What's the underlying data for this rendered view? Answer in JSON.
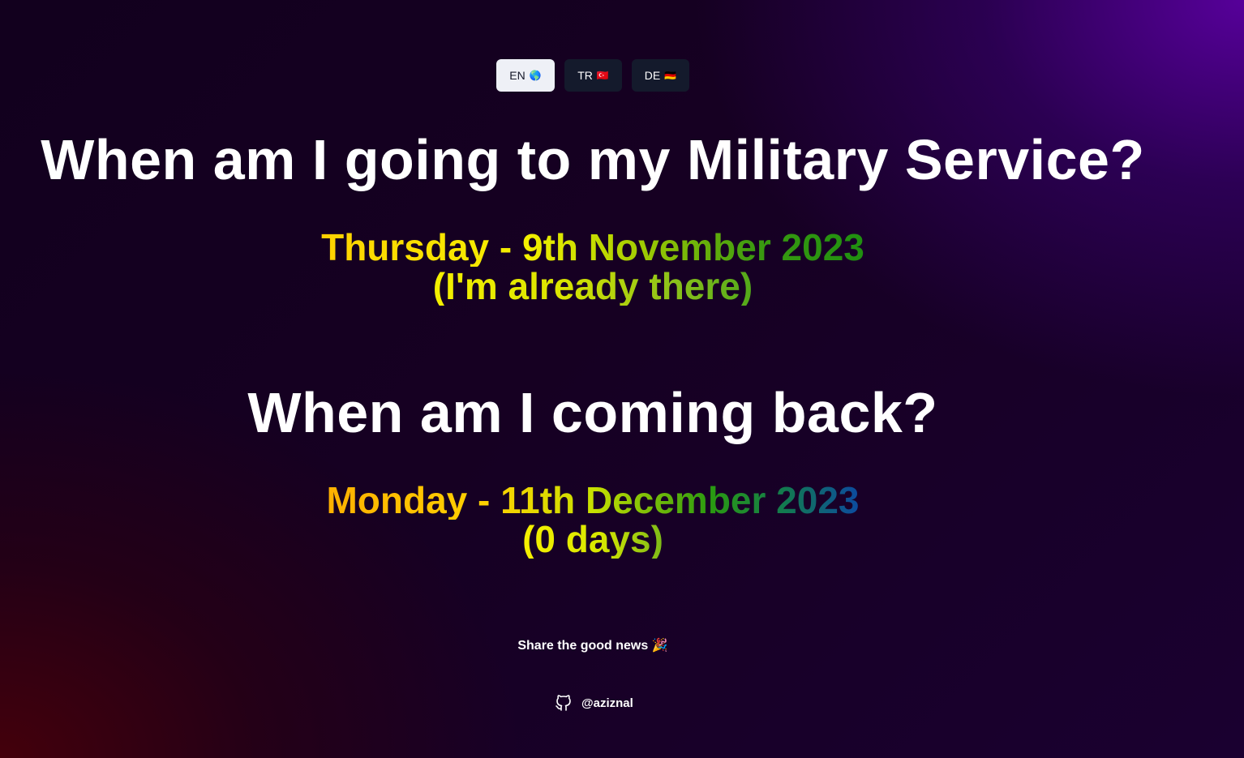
{
  "languages": [
    {
      "code": "EN",
      "flag": "🌎",
      "active": true
    },
    {
      "code": "TR",
      "flag": "🇹🇷",
      "active": false
    },
    {
      "code": "DE",
      "flag": "🇩🇪",
      "active": false
    }
  ],
  "going": {
    "question": "When am I going to my Military Service?",
    "date": "Thursday - 9th November 2023",
    "status": "(I'm already there)"
  },
  "back": {
    "question": "When am I coming back?",
    "date": "Monday - 11th December 2023",
    "status": "(0 days)"
  },
  "share": {
    "text": "Share the good news 🎉"
  },
  "footer": {
    "github_handle": "@aziznal",
    "icon": "github-icon"
  }
}
